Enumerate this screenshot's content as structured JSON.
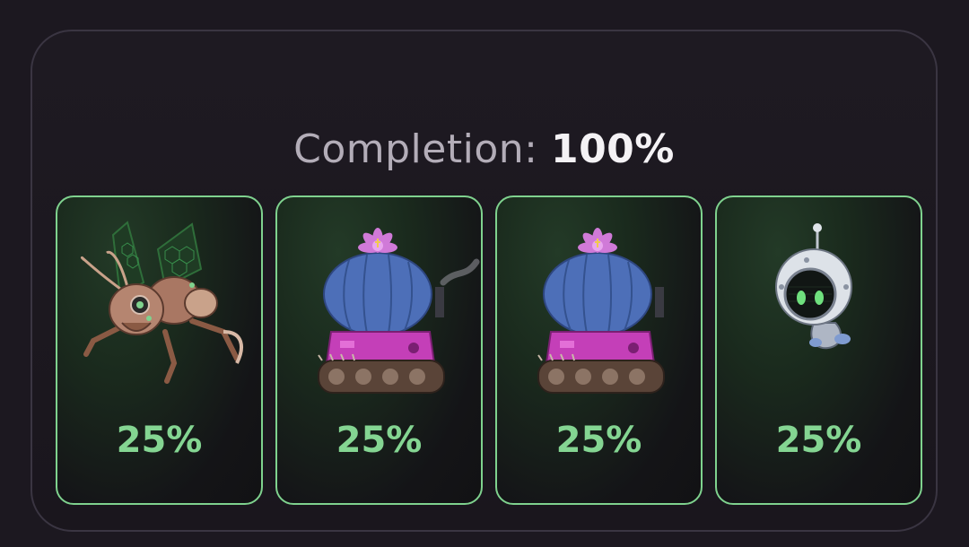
{
  "completion": {
    "label": "Completion:",
    "value": "100%"
  },
  "cards": [
    {
      "icon": "mech-insect-icon",
      "percent": "25%"
    },
    {
      "icon": "cactus-tank-icon",
      "percent": "25%"
    },
    {
      "icon": "cactus-tank-icon",
      "percent": "25%"
    },
    {
      "icon": "robot-astronaut-icon",
      "percent": "25%"
    }
  ],
  "colors": {
    "accent_green": "#84d592",
    "card_border": "#7fd28e",
    "background": "#1c1820"
  }
}
